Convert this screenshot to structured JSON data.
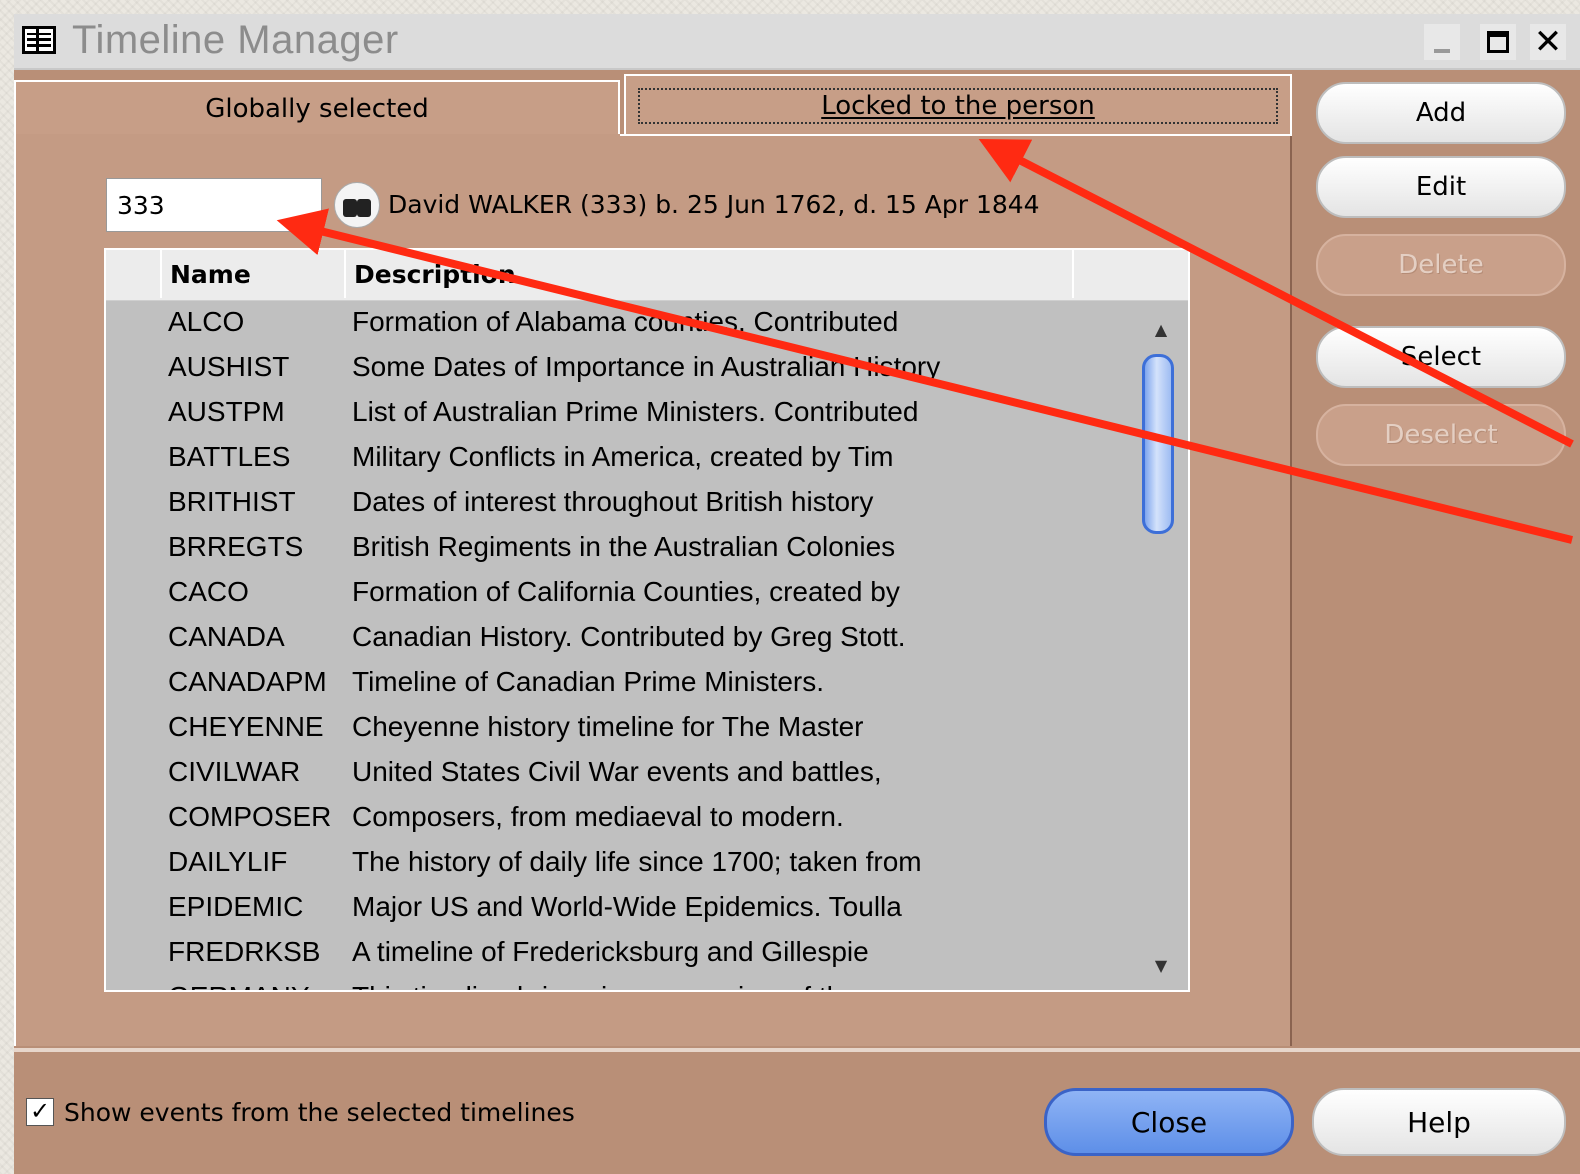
{
  "window": {
    "title": "Timeline Manager"
  },
  "tabs": {
    "global_label": "Globally selected",
    "locked_label": "Locked to the person"
  },
  "person": {
    "id_value": "333",
    "description": "David WALKER (333) b. 25 Jun 1762, d. 15 Apr 1844"
  },
  "table": {
    "columns": [
      "Name",
      "Description"
    ],
    "rows": [
      {
        "name": "ALCO",
        "description": "Formation of Alabama counties.  Contributed"
      },
      {
        "name": "AUSHIST",
        "description": "Some Dates of Importance in Australian History"
      },
      {
        "name": "AUSTPM",
        "description": "List of Australian Prime Ministers.  Contributed"
      },
      {
        "name": "BATTLES",
        "description": "Military Conflicts in America, created by Tim"
      },
      {
        "name": "BRITHIST",
        "description": "Dates of interest throughout British history"
      },
      {
        "name": "BRREGTS",
        "description": "British Regiments in the Australian Colonies"
      },
      {
        "name": "CACO",
        "description": "Formation of California Counties, created by"
      },
      {
        "name": "CANADA",
        "description": "Canadian History.  Contributed by Greg Stott."
      },
      {
        "name": "CANADAPM",
        "description": "Timeline of Canadian Prime Ministers."
      },
      {
        "name": "CHEYENNE",
        "description": "Cheyenne history timeline for The Master"
      },
      {
        "name": "CIVILWAR",
        "description": "United States Civil War events and battles,"
      },
      {
        "name": "COMPOSER",
        "description": "Composers, from mediaeval to modern."
      },
      {
        "name": "DAILYLIF",
        "description": "The history of daily life since 1700; taken from"
      },
      {
        "name": "EPIDEMIC",
        "description": "Major US and World-Wide Epidemics.  Toulla"
      },
      {
        "name": "FREDRKSB",
        "description": "A timeline of Fredericksburg and Gillespie"
      },
      {
        "name": "GERMANY",
        "description": "This timeline brings in an overview of the"
      }
    ]
  },
  "buttons": {
    "add": "Add",
    "edit": "Edit",
    "delete": "Delete",
    "select": "Select",
    "deselect": "Deselect",
    "close": "Close",
    "help": "Help"
  },
  "options": {
    "show_events_label": "Show events from the selected timelines",
    "show_events_checked": true,
    "check_mark": "✓"
  },
  "icons": {
    "app": "timeline-manager-icon",
    "find": "binoculars-icon"
  },
  "colors": {
    "panel": "#c49b84",
    "close_button": "#6f9cec",
    "annotation_arrow": "#ff2a12"
  }
}
